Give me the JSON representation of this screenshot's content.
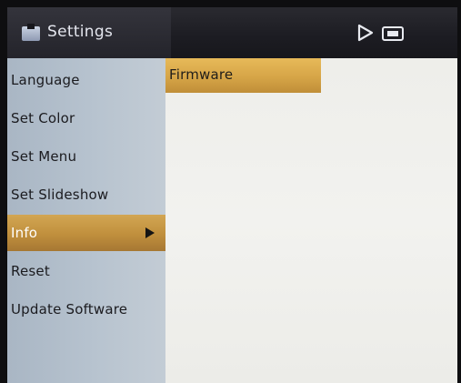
{
  "header": {
    "title": "Settings",
    "title_icon": "settings-folder-icon",
    "status_icons": [
      "play-icon",
      "memory-card-icon"
    ]
  },
  "sidebar": {
    "items": [
      {
        "label": "Language",
        "selected": false
      },
      {
        "label": "Set Color",
        "selected": false
      },
      {
        "label": "Set Menu",
        "selected": false
      },
      {
        "label": "Set Slideshow",
        "selected": false
      },
      {
        "label": "Info",
        "selected": true,
        "has_submenu": true
      },
      {
        "label": "Reset",
        "selected": false
      },
      {
        "label": "Update Software",
        "selected": false
      }
    ]
  },
  "content": {
    "items": [
      {
        "label": "Firmware",
        "selected": true
      }
    ]
  },
  "colors": {
    "selection": "#c99a44",
    "sidebar": "#b3bfcc",
    "header": "#1c1c22",
    "content": "#f0f0ed"
  }
}
